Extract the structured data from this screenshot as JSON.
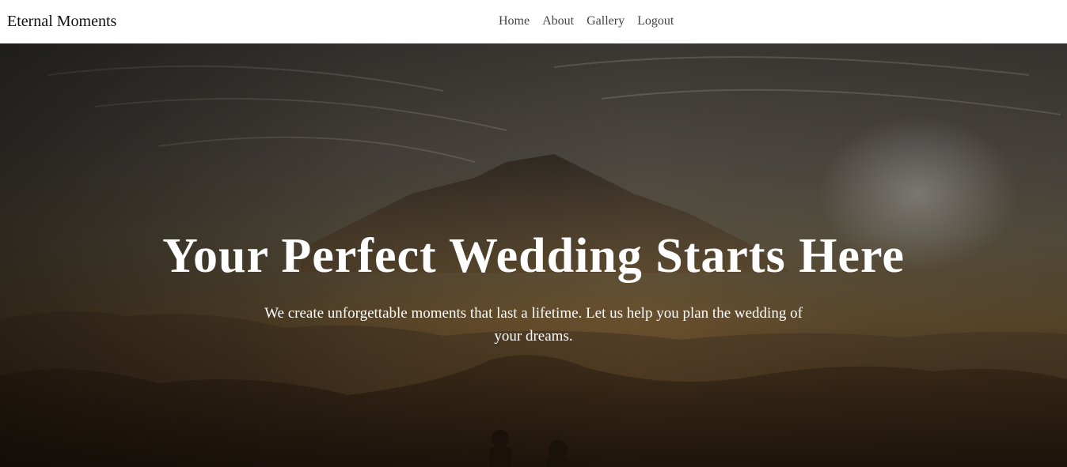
{
  "navbar": {
    "brand": "Eternal Moments",
    "links": [
      {
        "label": "Home"
      },
      {
        "label": "About"
      },
      {
        "label": "Gallery"
      },
      {
        "label": "Logout"
      }
    ]
  },
  "hero": {
    "title": "Your Perfect Wedding Starts Here",
    "subtitle": "We create unforgettable moments that last a lifetime. Let us help you plan the wedding of your dreams."
  },
  "colors": {
    "navbar_bg": "#ffffff",
    "hero_text": "#ffffff",
    "nav_link": "#444444",
    "brand": "#111111"
  }
}
